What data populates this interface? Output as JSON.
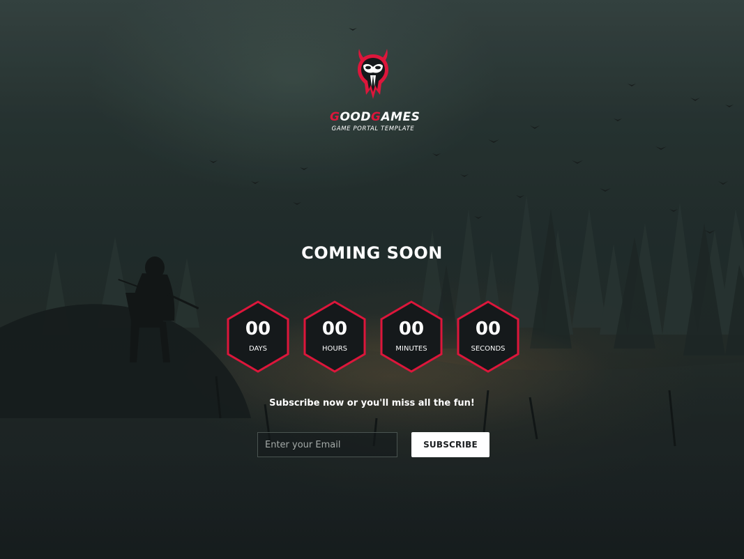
{
  "brand": {
    "name_parts": [
      {
        "text": "G",
        "accent": true
      },
      {
        "text": "OOD",
        "accent": false
      },
      {
        "text": "G",
        "accent": true
      },
      {
        "text": "AMES",
        "accent": false
      }
    ],
    "tagline": "GAME PORTAL TEMPLATE",
    "logo_icon": "horned-skull-mask-icon"
  },
  "title": "COMING SOON",
  "countdown": [
    {
      "value": "00",
      "label": "DAYS"
    },
    {
      "value": "00",
      "label": "HOURS"
    },
    {
      "value": "00",
      "label": "MINUTES"
    },
    {
      "value": "00",
      "label": "SECONDS"
    }
  ],
  "subscribe": {
    "text": "Subscribe now or you'll miss all the fun!",
    "email_placeholder": "Enter your Email",
    "email_value": "",
    "button_label": "SUBSCRIBE"
  },
  "colors": {
    "accent": "#dd163b",
    "hex_fill": "#15191b",
    "button_bg": "#ffffff",
    "button_text": "#1b1e20",
    "text": "#ffffff"
  }
}
